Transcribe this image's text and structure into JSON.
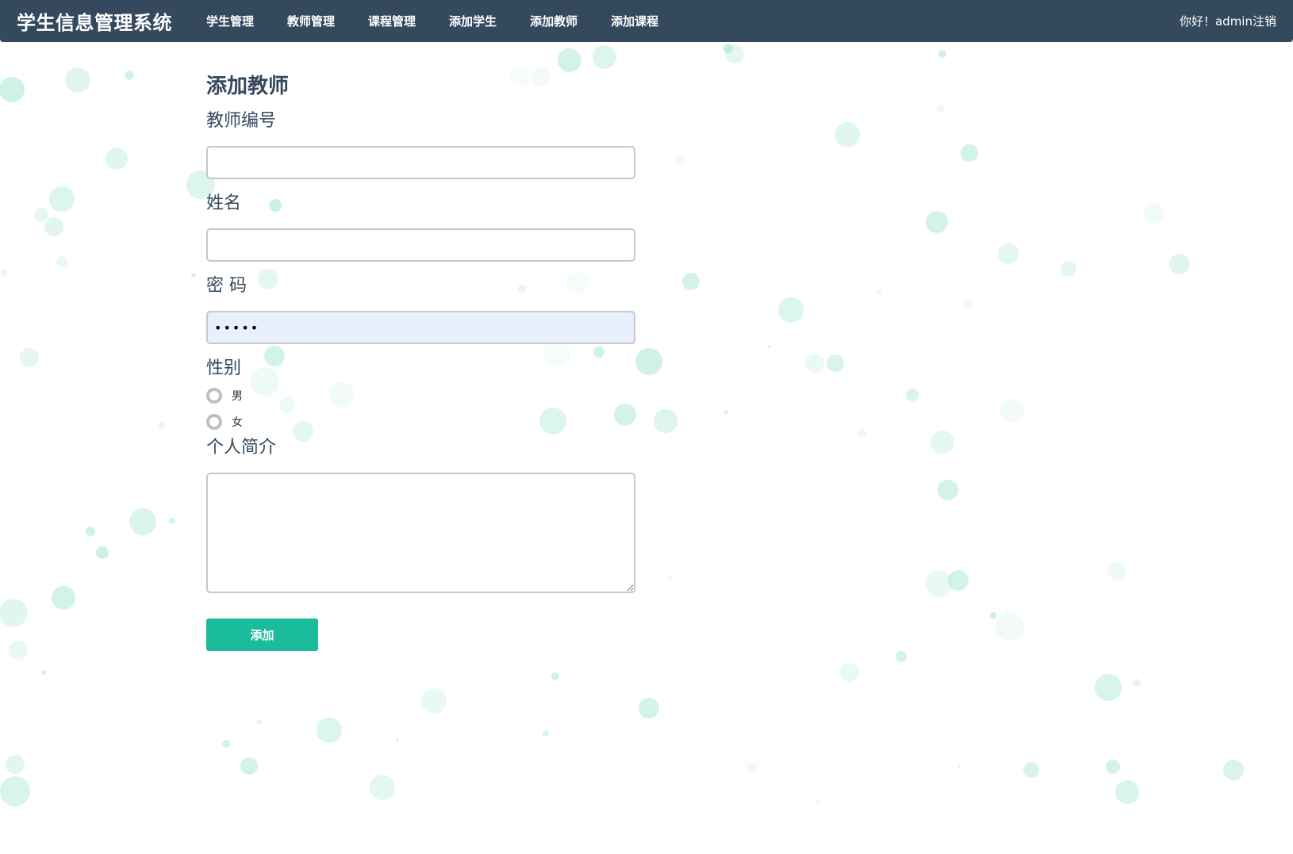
{
  "app": {
    "brand": "学生信息管理系统"
  },
  "nav": {
    "items": [
      {
        "label": "学生管理"
      },
      {
        "label": "教师管理"
      },
      {
        "label": "课程管理"
      },
      {
        "label": "添加学生"
      },
      {
        "label": "添加教师"
      },
      {
        "label": "添加课程"
      }
    ],
    "greeting": "你好！admin",
    "logout": "注销"
  },
  "form": {
    "title": "添加教师",
    "teacher_id": {
      "label": "教师编号",
      "value": ""
    },
    "name": {
      "label": "姓名",
      "value": ""
    },
    "password": {
      "label": "密 码",
      "value": "•••••"
    },
    "gender": {
      "label": "性别",
      "options": [
        {
          "label": "男"
        },
        {
          "label": "女"
        }
      ]
    },
    "bio": {
      "label": "个人简介",
      "value": ""
    },
    "submit_label": "添加"
  },
  "theme": {
    "navbar_bg": "#34495e",
    "accent": "#1abc9c",
    "bubble_color": "#a8e6d6",
    "autofill_bg": "#e8effd"
  }
}
